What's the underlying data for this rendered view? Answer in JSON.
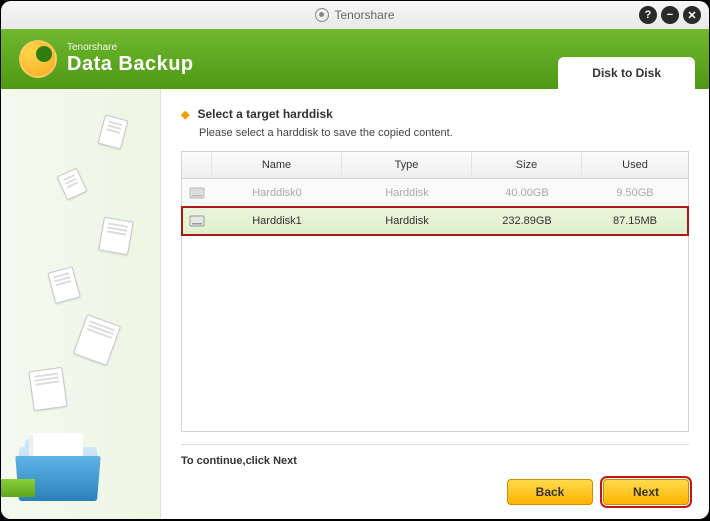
{
  "titlebar": {
    "brand": "Tenorshare"
  },
  "header": {
    "brand": "Tenorshare",
    "title": "Data Backup",
    "tab": "Disk to Disk"
  },
  "step": {
    "title": "Select a target harddisk",
    "desc": "Please select a harddisk to save the copied content."
  },
  "table": {
    "headers": {
      "name": "Name",
      "type": "Type",
      "size": "Size",
      "used": "Used"
    },
    "rows": [
      {
        "name": "Harddisk0",
        "type": "Harddisk",
        "size": "40.00GB",
        "used": "9.50GB",
        "selected": false
      },
      {
        "name": "Harddisk1",
        "type": "Harddisk",
        "size": "232.89GB",
        "used": "87.15MB",
        "selected": true
      }
    ]
  },
  "footer": {
    "continue": "To continue,click Next",
    "back": "Back",
    "next": "Next"
  }
}
